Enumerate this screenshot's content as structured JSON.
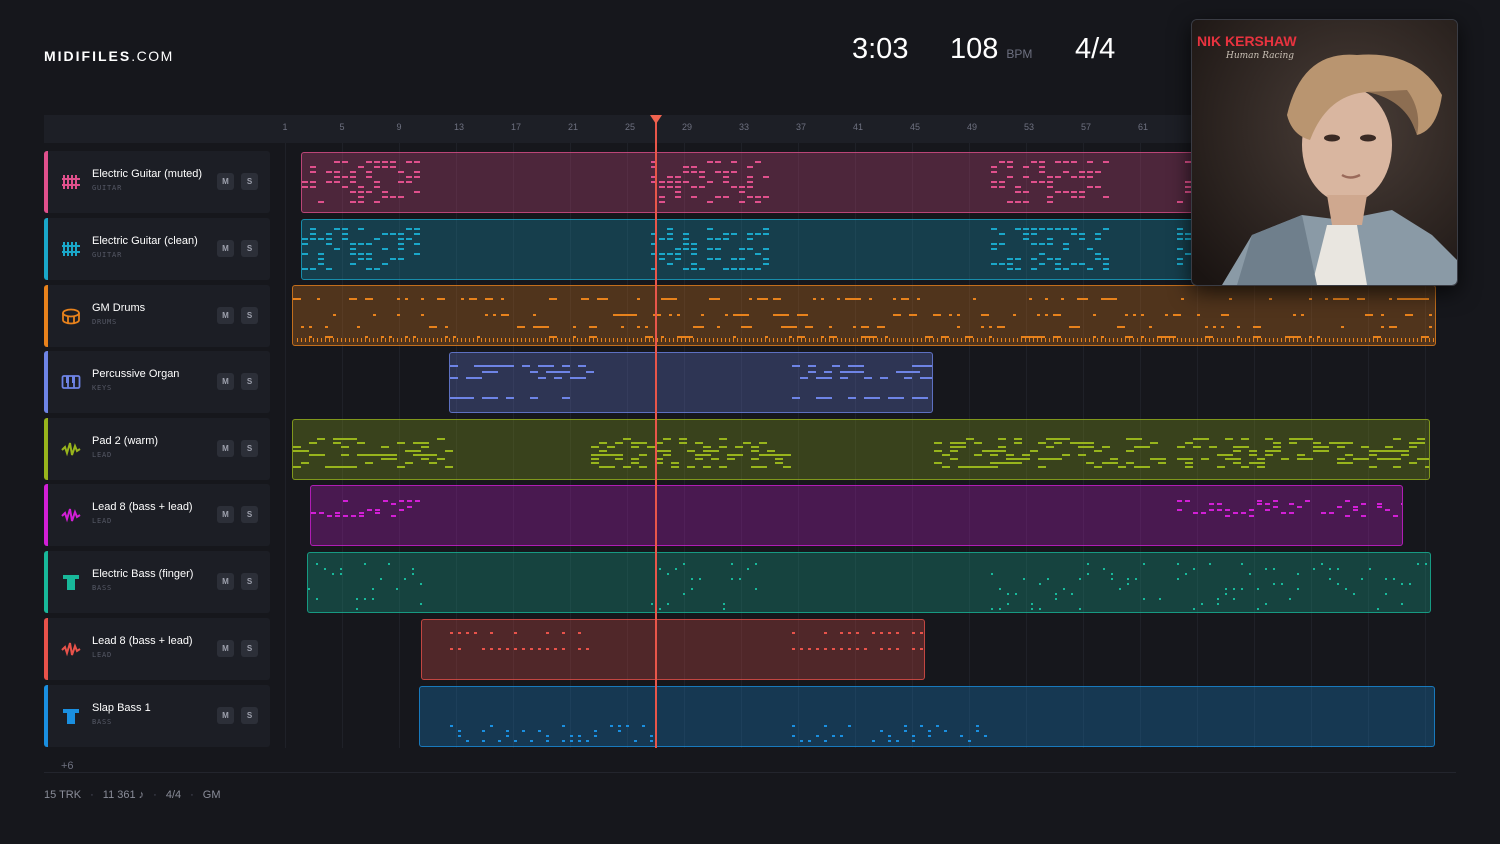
{
  "brand": {
    "name": "MIDIFILES",
    "domain": ".COM"
  },
  "transport": {
    "time": "3:03",
    "tempo": "108",
    "tempo_unit": "BPM",
    "signature": "4/4"
  },
  "album": {
    "artist": "NIK KERSHAW",
    "title": "Human Racing"
  },
  "ruler": {
    "ticks": [
      "1",
      "5",
      "9",
      "13",
      "17",
      "21",
      "25",
      "29",
      "33",
      "37",
      "41",
      "45",
      "49",
      "53",
      "57",
      "61"
    ]
  },
  "tracks": [
    {
      "name": "Electric Guitar (muted)",
      "category": "GUITAR",
      "icon": "guitar-icon",
      "color": "#e0508c",
      "mute": "M",
      "solo": "S"
    },
    {
      "name": "Electric Guitar (clean)",
      "category": "GUITAR",
      "icon": "guitar-icon",
      "color": "#1aa7c9",
      "mute": "M",
      "solo": "S"
    },
    {
      "name": "GM Drums",
      "category": "DRUMS",
      "icon": "drum-icon",
      "color": "#e8821c",
      "mute": "M",
      "solo": "S"
    },
    {
      "name": "Percussive Organ",
      "category": "KEYS",
      "icon": "keyboard-icon",
      "color": "#6e84e6",
      "mute": "M",
      "solo": "S"
    },
    {
      "name": "Pad 2 (warm)",
      "category": "LEAD",
      "icon": "wave-icon",
      "color": "#98b41c",
      "mute": "M",
      "solo": "S"
    },
    {
      "name": "Lead 8 (bass + lead)",
      "category": "LEAD",
      "icon": "wave-icon",
      "color": "#d21fd6",
      "mute": "M",
      "solo": "S"
    },
    {
      "name": "Electric Bass (finger)",
      "category": "BASS",
      "icon": "bass-icon",
      "color": "#18b89a",
      "mute": "M",
      "solo": "S"
    },
    {
      "name": "Lead 8 (bass + lead)",
      "category": "LEAD",
      "icon": "wave-icon",
      "color": "#e8524a",
      "mute": "M",
      "solo": "S"
    },
    {
      "name": "Slap Bass 1",
      "category": "BASS",
      "icon": "bass-icon",
      "color": "#1a8fe0",
      "mute": "M",
      "solo": "S"
    }
  ],
  "more_tracks": "+6",
  "footer": {
    "tracks": "15 TRK",
    "notes": "11 361 ♪",
    "signature": "4/4",
    "standard": "GM"
  }
}
